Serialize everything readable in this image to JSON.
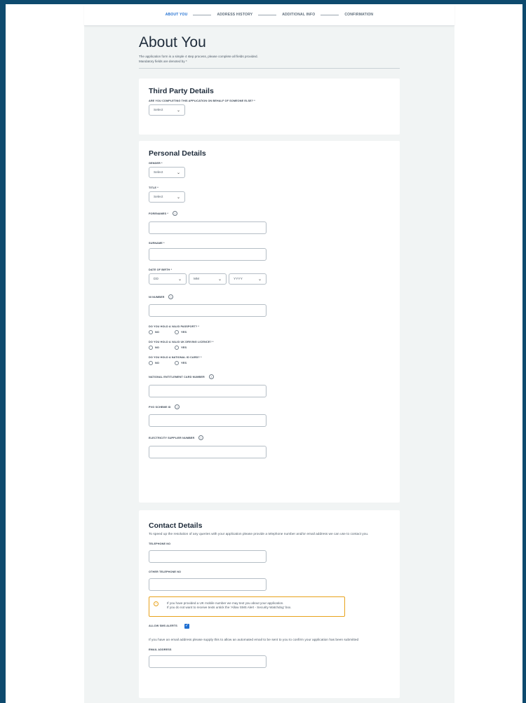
{
  "stepper": {
    "steps": [
      "ABOUT YOU",
      "ADDRESS HISTORY",
      "ADDITIONAL INFO",
      "CONFIRMATION"
    ],
    "active_index": 0
  },
  "intro": {
    "title": "About You",
    "line1": "The application form is a simple 4 step process, please complete all fields provided.",
    "line2": "Mandatory fields are denoted by *"
  },
  "third_party": {
    "heading": "Third Party Details",
    "question": "ARE YOU COMPLETING THIS APPLICATION ON BEHALF OF SOMEONE ELSE? *",
    "select_value": "Select"
  },
  "personal": {
    "heading": "Personal Details",
    "gender_label": "GENDER *",
    "gender_value": "Select",
    "title_label": "TITLE *",
    "title_value": "Select",
    "forenames_label": "FORENAMES *",
    "surname_label": "SURNAME *",
    "dob_label": "DATE OF BIRTH *",
    "dob_dd": "DD",
    "dob_mm": "MM",
    "dob_yyyy": "YYYY",
    "ni_label": "NI NUMBER",
    "passport_label": "DO YOU HOLD A VALID PASSPORT? *",
    "licence_label": "DO YOU HOLD A VALID UK DRIVING LICENCE? *",
    "idcard_label": "DO YOU HOLD A NATIONAL ID CARD? *",
    "no_label": "NO",
    "yes_label": "YES",
    "entitlement_label": "NATIONAL ENTITLEMENT CARD NUMBER",
    "pvg_label": "PVG SCHEME ID",
    "electricity_label": "ELECTRICITY SUPPLIER NUMBER",
    "info_glyph": "i"
  },
  "contact": {
    "heading": "Contact Details",
    "desc": "To speed up the resolution of any queries with your application please provide a telephone number and/or email address we can use to contact you.",
    "telephone_label": "TELEPHONE NO",
    "other_telephone_label": "OTHER TELEPHONE NO",
    "notice_line1": "If you have provided a UK mobile number we may text you about your application.",
    "notice_line2": "If you do not want to receive texts untick the 'Allow SMS Alert - Security Watchdog' box.",
    "sms_label": "ALLOW SMS ALERTS",
    "sms_checked": true,
    "email_desc": "If you have an email address please supply this to allow an automated email to be sent to you to confirm your application has been submitted",
    "email_label": "EMAIL ADDRESS"
  },
  "colors": {
    "frame": "#0e4a6e",
    "accent": "#1f6fd1",
    "notice_border": "#e8a21c",
    "page_bg": "#f1f4f4"
  }
}
